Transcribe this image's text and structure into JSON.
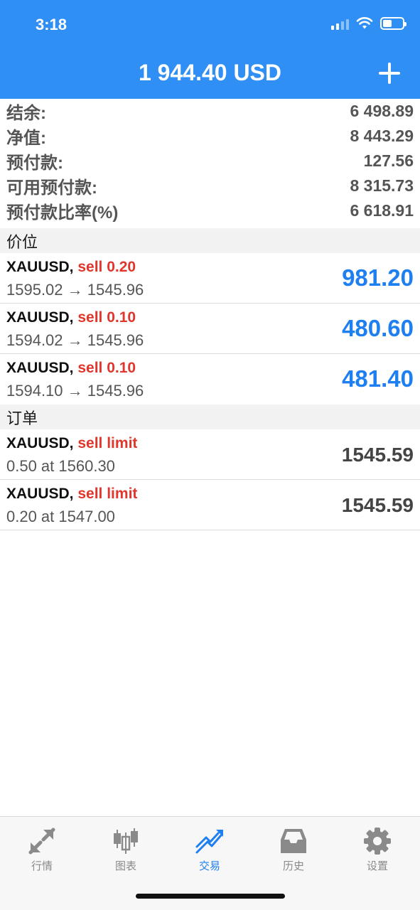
{
  "status_bar": {
    "time": "3:18"
  },
  "header": {
    "title": "1 944.40 USD"
  },
  "summary": [
    {
      "label": "结余:",
      "value": "6 498.89"
    },
    {
      "label": "净值:",
      "value": "8 443.29"
    },
    {
      "label": "预付款:",
      "value": "127.56"
    },
    {
      "label": "可用预付款:",
      "value": "8 315.73"
    },
    {
      "label": "预付款比率(%)",
      "value": "6 618.91"
    }
  ],
  "positions": {
    "header": "价位",
    "items": [
      {
        "symbol": "XAUUSD,",
        "side": "sell 0.20",
        "detail": "1595.02 → 1545.96",
        "profit": "981.20"
      },
      {
        "symbol": "XAUUSD,",
        "side": "sell 0.10",
        "detail": "1594.02 → 1545.96",
        "profit": "480.60"
      },
      {
        "symbol": "XAUUSD,",
        "side": "sell 0.10",
        "detail": "1594.10 → 1545.96",
        "profit": "481.40"
      }
    ]
  },
  "orders": {
    "header": "订单",
    "items": [
      {
        "symbol": "XAUUSD,",
        "side": "sell limit",
        "detail": "0.50 at 1560.30",
        "price": "1545.59"
      },
      {
        "symbol": "XAUUSD,",
        "side": "sell limit",
        "detail": "0.20 at 1547.00",
        "price": "1545.59"
      }
    ]
  },
  "tabs": [
    {
      "label": "行情",
      "icon": "quotes-arrows-icon"
    },
    {
      "label": "图表",
      "icon": "candlestick-chart-icon"
    },
    {
      "label": "交易",
      "icon": "trade-trend-icon",
      "active": true
    },
    {
      "label": "历史",
      "icon": "inbox-tray-icon"
    },
    {
      "label": "设置",
      "icon": "gear-icon"
    }
  ],
  "colors": {
    "accent": "#2f8ff4",
    "profit": "#1e7ff0",
    "sell": "#e0362c"
  }
}
